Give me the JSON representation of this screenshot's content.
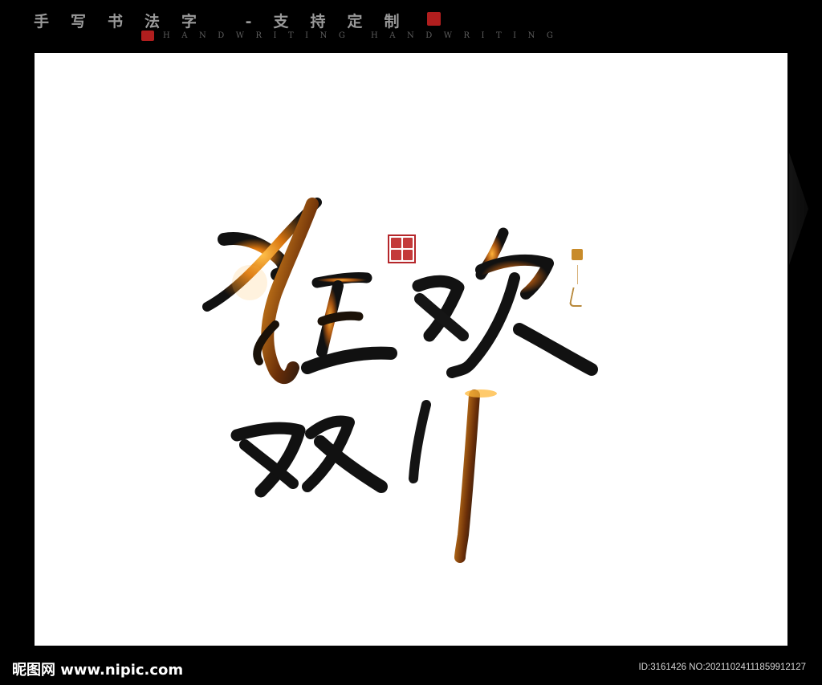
{
  "header": {
    "title": "手写书法字  -支持定制",
    "subtitle": "HANDWRITING  HANDWRITING"
  },
  "calligraphy": {
    "characters": [
      "狂",
      "欢",
      "双",
      "11"
    ],
    "ink_color": "#111111",
    "glow_color": "#f0a020"
  },
  "footer": {
    "logo": "昵图网 www.nipic.com",
    "image_id": "ID:3161426 NO:20211024111859912127"
  },
  "colors": {
    "background": "#000000",
    "canvas": "#ffffff",
    "seal_red": "#b01e1e"
  }
}
